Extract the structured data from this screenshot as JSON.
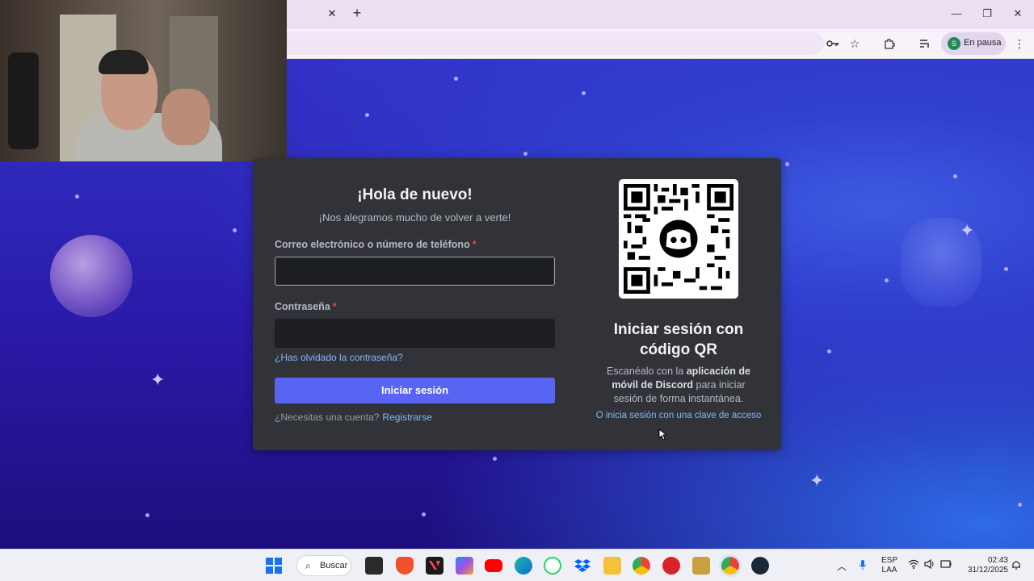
{
  "browser": {
    "tab_close_glyph": "✕",
    "new_tab_glyph": "+",
    "profile_initial": "S",
    "profile_status": "En pausa",
    "window_controls": {
      "minimize": "—",
      "restore": "❐",
      "close": "✕"
    }
  },
  "login": {
    "title": "¡Hola de nuevo!",
    "subtitle": "¡Nos alegramos mucho de volver a verte!",
    "email_label": "Correo electrónico o número de teléfono",
    "password_label": "Contraseña",
    "required_mark": "*",
    "email_value": "",
    "password_value": "",
    "forgot_password": "¿Has olvidado la contraseña?",
    "login_button": "Iniciar sesión",
    "need_account": "¿Necesitas una cuenta?",
    "register_link": "Registrarse"
  },
  "qr": {
    "title_line1": "Iniciar sesión con",
    "title_line2": "código QR",
    "desc_pre": "Escanéalo con la ",
    "desc_bold": "aplicación de móvil de Discord",
    "desc_post": " para iniciar sesión de forma instantánea.",
    "passkey_link": "O inicia sesión con una clave de acceso"
  },
  "taskbar": {
    "search_label": "Buscar",
    "lang_top": "ESP",
    "lang_bottom": "LAA",
    "time": "02:43",
    "date": "31/12/2025",
    "apps": [
      "file-explorer-icon",
      "brave-icon",
      "valorant-icon",
      "copilot-icon",
      "youtube-icon",
      "edge-icon",
      "whatsapp-icon",
      "dropbox-icon",
      "folder-icon",
      "chrome-icon",
      "app-red-icon",
      "app-gold-icon",
      "chrome-active-icon",
      "steam-icon"
    ]
  },
  "colors": {
    "accent": "#5865f2",
    "card_bg": "#313338",
    "input_bg": "#1e1f22",
    "link": "#8ab4f8",
    "required": "#f23f42"
  }
}
